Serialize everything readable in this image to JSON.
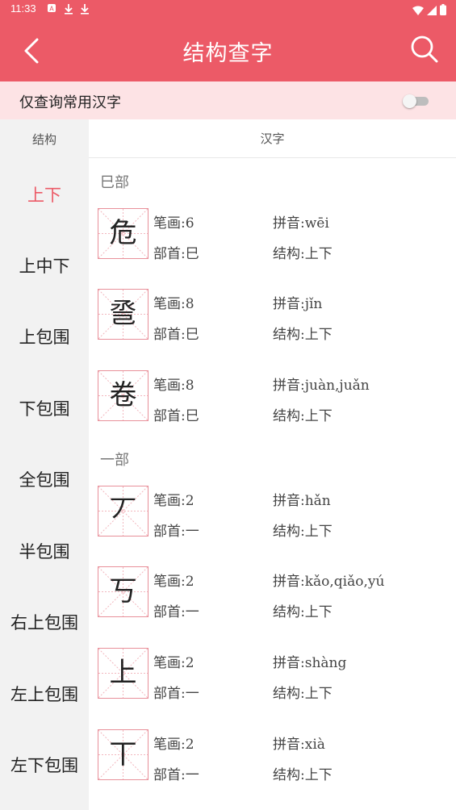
{
  "status_bar": {
    "time": "11:33",
    "notifications": [
      "a-icon",
      "download-icon",
      "download-icon"
    ],
    "icons": [
      "wifi-icon",
      "signal-icon",
      "battery-icon"
    ]
  },
  "app_bar": {
    "title": "结构查字",
    "back_icon": "chevron-left-icon",
    "search_icon": "search-icon"
  },
  "filter": {
    "label": "仅查询常用汉字",
    "toggle_on": false
  },
  "columns": {
    "structure_header": "结构",
    "chars_header": "汉字"
  },
  "sidebar": {
    "items": [
      {
        "label": "上下",
        "active": true
      },
      {
        "label": "上中下",
        "active": false
      },
      {
        "label": "上包围",
        "active": false
      },
      {
        "label": "下包围",
        "active": false
      },
      {
        "label": "全包围",
        "active": false
      },
      {
        "label": "半包围",
        "active": false
      },
      {
        "label": "右上包围",
        "active": false
      },
      {
        "label": "左上包围",
        "active": false
      },
      {
        "label": "左下包围",
        "active": false
      }
    ]
  },
  "sections": [
    {
      "title": "巳部",
      "entries": [
        {
          "char": "危",
          "strokes": "笔画:6",
          "pinyin": "拼音:wēi",
          "radical": "部首:巳",
          "structure": "结构:上下"
        },
        {
          "char": "巹",
          "strokes": "笔画:8",
          "pinyin": "拼音:jǐn",
          "radical": "部首:巳",
          "structure": "结构:上下"
        },
        {
          "char": "卷",
          "strokes": "笔画:8",
          "pinyin": "拼音:juàn,juǎn",
          "radical": "部首:巳",
          "structure": "结构:上下"
        }
      ]
    },
    {
      "title": "一部",
      "entries": [
        {
          "char": "丆",
          "strokes": "笔画:2",
          "pinyin": "拼音:hǎn",
          "radical": "部首:一",
          "structure": "结构:上下"
        },
        {
          "char": "丂",
          "strokes": "笔画:2",
          "pinyin": "拼音:kǎo,qiǎo,yú",
          "radical": "部首:一",
          "structure": "结构:上下"
        },
        {
          "char": "上",
          "strokes": "笔画:2",
          "pinyin": "拼音:shàng",
          "radical": "部首:一",
          "structure": "结构:上下"
        },
        {
          "char": "丅",
          "strokes": "笔画:2",
          "pinyin": "拼音:xià",
          "radical": "部首:一",
          "structure": "结构:上下"
        }
      ]
    }
  ],
  "colors": {
    "accent": "#ec5a67",
    "filter_bg": "#fde3e5",
    "sidebar_bg": "#f2f2f2",
    "grid_line": "#e8909a"
  }
}
